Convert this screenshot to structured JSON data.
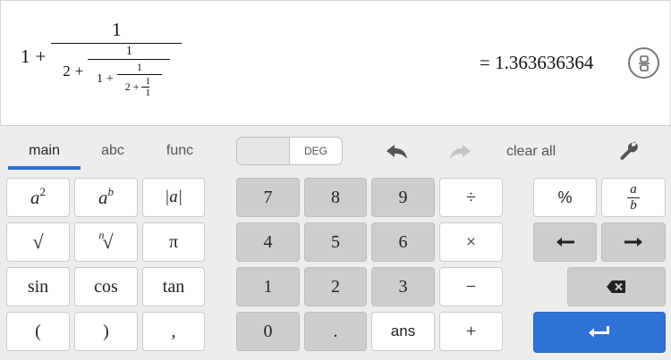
{
  "display": {
    "expr": {
      "one_a": "1",
      "plus_a": "+",
      "num_a": "1",
      "two_b": "2",
      "plus_b": "+",
      "num_b": "1",
      "one_c": "1",
      "plus_c": "+",
      "num_c": "1",
      "two_d": "2",
      "plus_d": "+",
      "num_d": "1",
      "den_d": "1"
    },
    "result": "= 1.363636364"
  },
  "tabs": [
    {
      "label": "main"
    },
    {
      "label": "abc"
    },
    {
      "label": "func"
    }
  ],
  "toolbar": {
    "deg_label": "DEG",
    "clear_all": "clear all"
  },
  "functions": {
    "square": "a",
    "square_exp": "2",
    "power": "a",
    "power_exp": "b",
    "abs": "|a|",
    "sqrt": "√",
    "nthroot_n": "n",
    "nthroot": "√",
    "pi": "π",
    "sin": "sin",
    "cos": "cos",
    "tan": "tan",
    "lparen": "(",
    "rparen": ")",
    "comma": ","
  },
  "numpad": {
    "k7": "7",
    "k8": "8",
    "k9": "9",
    "div": "÷",
    "k4": "4",
    "k5": "5",
    "k6": "6",
    "mul": "×",
    "k1": "1",
    "k2": "2",
    "k3": "3",
    "minus": "−",
    "k0": "0",
    "dot": ".",
    "ans": "ans",
    "plus": "+"
  },
  "extra": {
    "percent": "%",
    "frac_num": "a",
    "frac_den": "b"
  },
  "colors": {
    "accent": "#2b6fd6",
    "enter_key": "#2f72d6",
    "gray_key": "#cdcdcd"
  }
}
